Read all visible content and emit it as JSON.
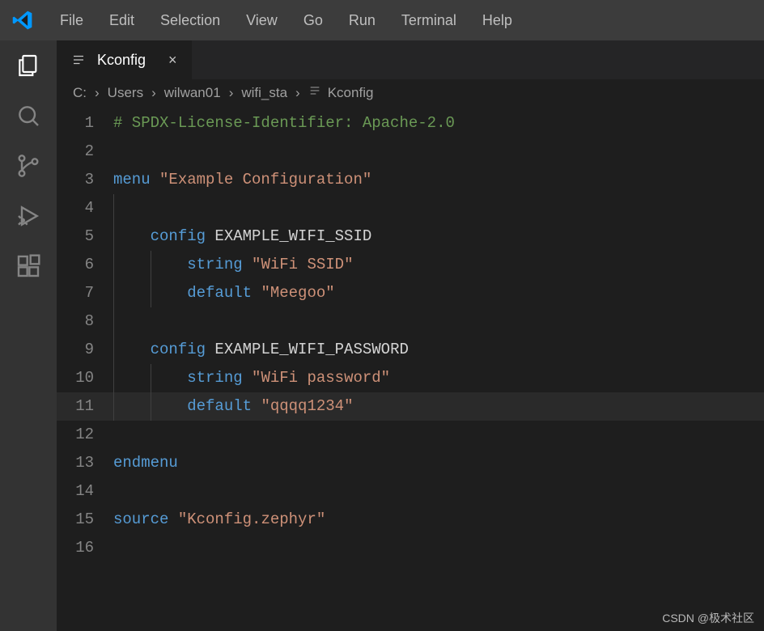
{
  "menu": {
    "items": [
      "File",
      "Edit",
      "Selection",
      "View",
      "Go",
      "Run",
      "Terminal",
      "Help"
    ]
  },
  "activity": {
    "items": [
      {
        "name": "explorer-icon",
        "active": true
      },
      {
        "name": "search-icon",
        "active": false
      },
      {
        "name": "source-control-icon",
        "active": false
      },
      {
        "name": "run-debug-icon",
        "active": false
      },
      {
        "name": "extensions-icon",
        "active": false
      }
    ]
  },
  "tab": {
    "label": "Kconfig",
    "close_glyph": "×"
  },
  "breadcrumb": {
    "parts": [
      "C:",
      "Users",
      "wilwan01",
      "wifi_sta",
      "Kconfig"
    ]
  },
  "code": {
    "lines": [
      {
        "n": 1,
        "indent": 0,
        "guides": 0,
        "seg": [
          {
            "c": "comment",
            "t": "# SPDX-License-Identifier: Apache-2.0"
          }
        ]
      },
      {
        "n": 2,
        "indent": 0,
        "guides": 0,
        "seg": []
      },
      {
        "n": 3,
        "indent": 0,
        "guides": 0,
        "seg": [
          {
            "c": "kw",
            "t": "menu"
          },
          {
            "c": "plain",
            "t": " "
          },
          {
            "c": "str",
            "t": "\"Example Configuration\""
          }
        ]
      },
      {
        "n": 4,
        "indent": 1,
        "guides": 1,
        "seg": []
      },
      {
        "n": 5,
        "indent": 1,
        "guides": 1,
        "seg": [
          {
            "c": "kw",
            "t": "config"
          },
          {
            "c": "plain",
            "t": " EXAMPLE_WIFI_SSID"
          }
        ]
      },
      {
        "n": 6,
        "indent": 2,
        "guides": 2,
        "seg": [
          {
            "c": "kw",
            "t": "string"
          },
          {
            "c": "plain",
            "t": " "
          },
          {
            "c": "str",
            "t": "\"WiFi SSID\""
          }
        ]
      },
      {
        "n": 7,
        "indent": 2,
        "guides": 2,
        "seg": [
          {
            "c": "kw",
            "t": "default"
          },
          {
            "c": "plain",
            "t": " "
          },
          {
            "c": "str",
            "t": "\"Meegoo\""
          }
        ]
      },
      {
        "n": 8,
        "indent": 1,
        "guides": 1,
        "seg": []
      },
      {
        "n": 9,
        "indent": 1,
        "guides": 1,
        "seg": [
          {
            "c": "kw",
            "t": "config"
          },
          {
            "c": "plain",
            "t": " EXAMPLE_WIFI_PASSWORD"
          }
        ]
      },
      {
        "n": 10,
        "indent": 2,
        "guides": 2,
        "seg": [
          {
            "c": "kw",
            "t": "string"
          },
          {
            "c": "plain",
            "t": " "
          },
          {
            "c": "str",
            "t": "\"WiFi password\""
          }
        ]
      },
      {
        "n": 11,
        "indent": 2,
        "guides": 2,
        "hl": true,
        "seg": [
          {
            "c": "kw",
            "t": "default"
          },
          {
            "c": "plain",
            "t": " "
          },
          {
            "c": "str",
            "t": "\"qqqq1234\""
          }
        ]
      },
      {
        "n": 12,
        "indent": 0,
        "guides": 0,
        "seg": []
      },
      {
        "n": 13,
        "indent": 0,
        "guides": 0,
        "seg": [
          {
            "c": "kw",
            "t": "endmenu"
          }
        ]
      },
      {
        "n": 14,
        "indent": 0,
        "guides": 0,
        "seg": []
      },
      {
        "n": 15,
        "indent": 0,
        "guides": 0,
        "seg": [
          {
            "c": "kw",
            "t": "source"
          },
          {
            "c": "plain",
            "t": " "
          },
          {
            "c": "str",
            "t": "\"Kconfig.zephyr\""
          }
        ]
      },
      {
        "n": 16,
        "indent": 0,
        "guides": 0,
        "seg": []
      }
    ],
    "indent_width": 4
  },
  "watermark": "CSDN @极术社区"
}
